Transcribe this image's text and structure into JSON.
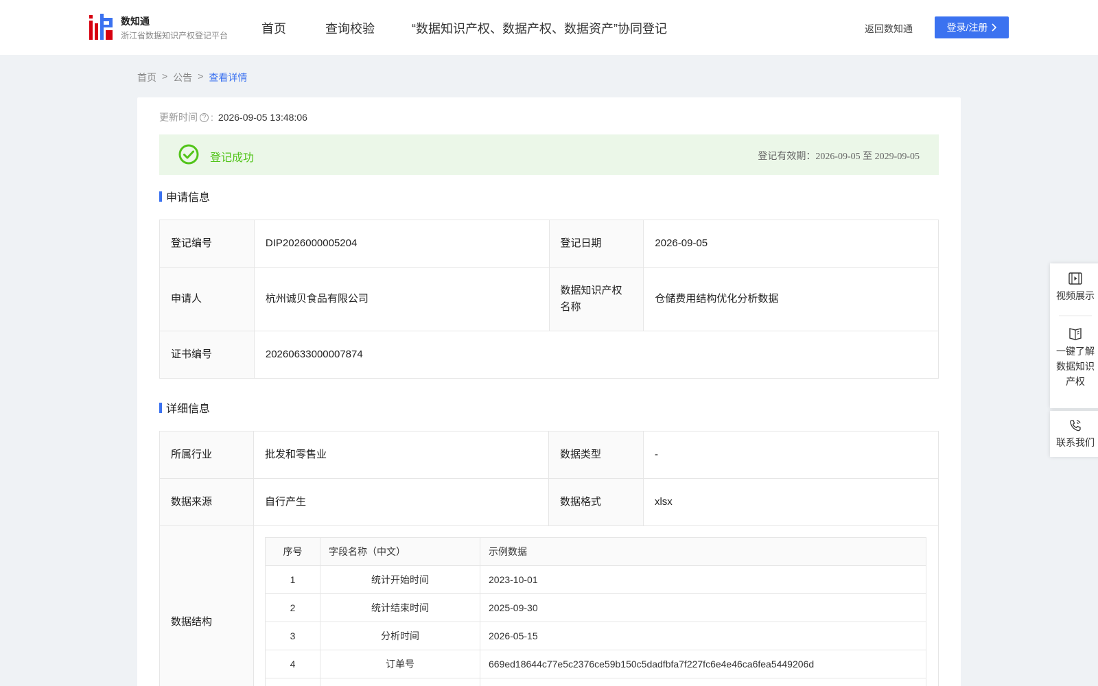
{
  "header": {
    "brand_name": "数知通",
    "brand_subtitle": "浙江省数据知识产权登记平台",
    "nav": [
      "首页",
      "查询校验",
      "“数据知识产权、数据产权、数据资产”协同登记"
    ],
    "back_link": "返回数知通",
    "login_button": "登录/注册",
    "accent_color": "#3b72f0",
    "logo_colors": [
      "#d7000f",
      "#3b72f0"
    ]
  },
  "breadcrumb": {
    "items": [
      "首页",
      "公告"
    ],
    "current": "查看详情",
    "separator": ">"
  },
  "update": {
    "label": "更新时间",
    "colon": ":",
    "value": "2026-09-05 13:48:06"
  },
  "status": {
    "text": "登记成功",
    "validity": "登记有效期：2026-09-05 至 2029-09-05",
    "color": "#52c41a"
  },
  "application": {
    "title": "申请信息",
    "reg_no_label": "登记编号",
    "reg_no": "DIP2026000005204",
    "reg_date_label": "登记日期",
    "reg_date": "2026-09-05",
    "applicant_label": "申请人",
    "applicant": "杭州诚贝食品有限公司",
    "ip_name_label": "数据知识产权名称",
    "ip_name": "仓储费用结构优化分析数据",
    "cert_no_label": "证书编号",
    "cert_no": "20260633000007874"
  },
  "details": {
    "title": "详细信息",
    "industry_label": "所属行业",
    "industry": "批发和零售业",
    "data_type_label": "数据类型",
    "data_type": "-",
    "source_label": "数据来源",
    "source": "自行产生",
    "format_label": "数据格式",
    "format": "xlsx",
    "structure_label": "数据结构",
    "field_headers": {
      "no": "序号",
      "name": "字段名称（中文）",
      "sample": "示例数据"
    },
    "fields": [
      {
        "no": "1",
        "name": "统计开始时间",
        "sample": "2023-10-01"
      },
      {
        "no": "2",
        "name": "统计结束时间",
        "sample": "2025-09-30"
      },
      {
        "no": "3",
        "name": "分析时间",
        "sample": "2026-05-15"
      },
      {
        "no": "4",
        "name": "订单号",
        "sample": "669ed18644c77e5c2376ce59b150c5dadfbfa7f227fc6e4e46ca6fea5449206d"
      },
      {
        "no": "",
        "name": "",
        "sample": ""
      }
    ]
  },
  "side": {
    "video_label": "视频展示",
    "learn_label": "一键了解数据知识产权",
    "contact_label": "联系我们",
    "icons": [
      "video-icon",
      "book-icon",
      "phone-icon"
    ]
  }
}
